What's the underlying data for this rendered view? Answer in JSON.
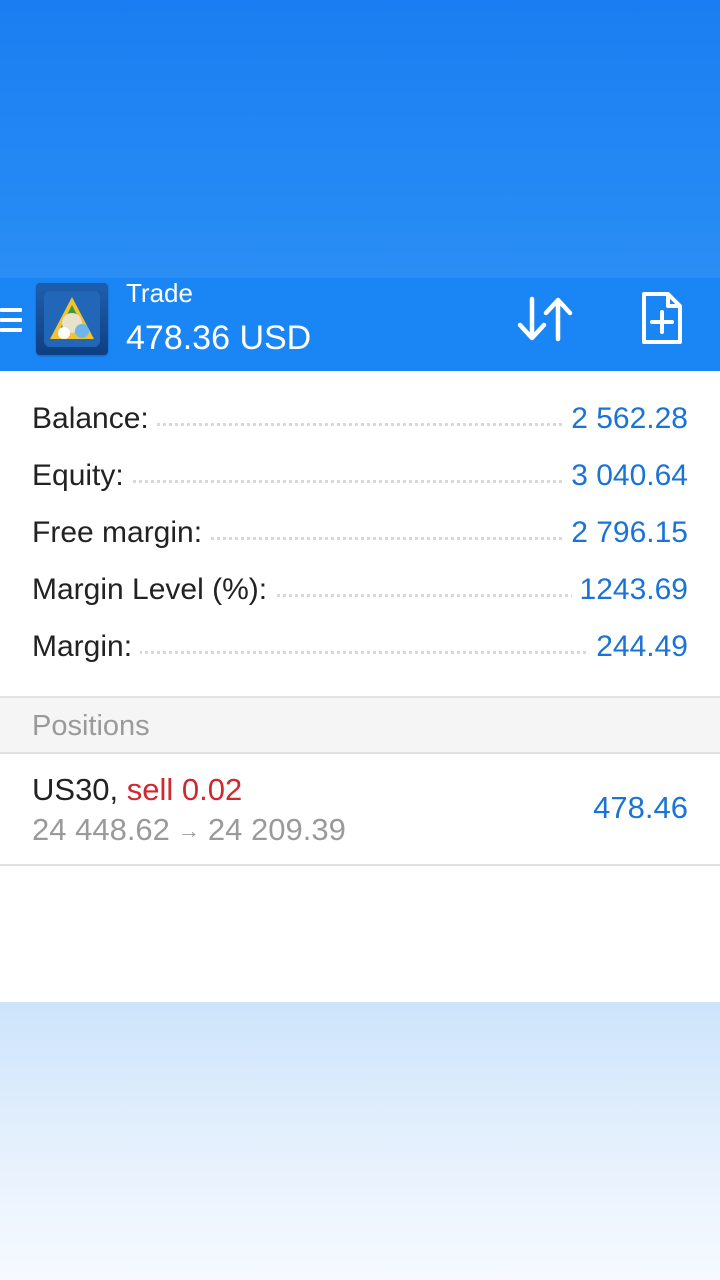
{
  "header": {
    "title": "Trade",
    "profit_display": "478.36 USD",
    "icons": {
      "menu": "hamburger-menu-icon",
      "logo": "metatrader-logo",
      "sort": "sort-arrows-icon",
      "new_order": "new-order-document-plus-icon"
    }
  },
  "account": {
    "rows": [
      {
        "label": "Balance:",
        "value": "2 562.28"
      },
      {
        "label": "Equity:",
        "value": "3 040.64"
      },
      {
        "label": "Free margin:",
        "value": "2 796.15"
      },
      {
        "label": "Margin Level (%):",
        "value": "1243.69"
      },
      {
        "label": "Margin:",
        "value": "244.49"
      }
    ]
  },
  "positions": {
    "section_title": "Positions",
    "items": [
      {
        "symbol": "US30,",
        "side": "sell 0.02",
        "open_price": "24 448.62",
        "arrow": "→",
        "current_price": "24 209.39",
        "profit": "478.46"
      }
    ]
  },
  "colors": {
    "app_bar": "#1a86f5",
    "value_blue": "#1a73d6",
    "sell_red": "#d0282e",
    "muted_gray": "#9a9a9a",
    "label_dark": "#222222"
  }
}
